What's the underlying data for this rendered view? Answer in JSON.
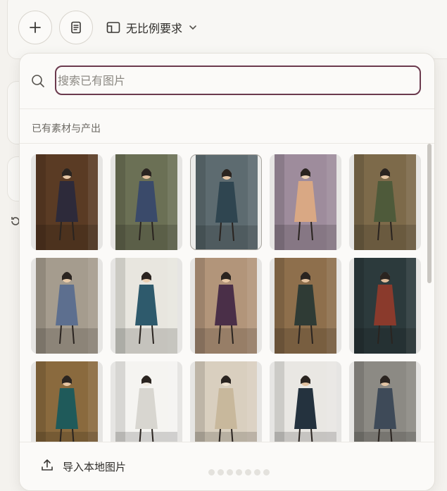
{
  "toolbar": {
    "add_icon": "plus-icon",
    "doc_icon": "document-icon",
    "ratio_icon": "aspect-ratio-icon",
    "ratio_label": "无比例要求",
    "ratio_chevron": "chevron-down-icon"
  },
  "picker": {
    "search_placeholder": "搜索已有图片",
    "section_title": "已有素材与产出",
    "upload_label": "导入本地图片",
    "accent_color": "#6b3a4e"
  },
  "thumbnails": [
    {
      "row": 0,
      "col": 0,
      "bg": "#5a3b24",
      "fig": "#2d2a3a",
      "skin": "#e8c9a8",
      "selected": false
    },
    {
      "row": 0,
      "col": 1,
      "bg": "#6b7055",
      "fig": "#3a4a6a",
      "skin": "#e3c09c",
      "selected": false
    },
    {
      "row": 0,
      "col": 2,
      "bg": "#5d6b70",
      "fig": "#2f4550",
      "skin": "#e5c6a6",
      "selected": true
    },
    {
      "row": 0,
      "col": 3,
      "bg": "#9e8c9c",
      "fig": "#d9a884",
      "skin": "#edd2b6",
      "selected": false
    },
    {
      "row": 0,
      "col": 4,
      "bg": "#7d6a4a",
      "fig": "#4e5a3a",
      "skin": "#e6c7a5",
      "selected": false
    },
    {
      "row": 1,
      "col": 0,
      "bg": "#a59c8e",
      "fig": "#5d6f8f",
      "skin": "#e8caa8",
      "selected": false
    },
    {
      "row": 1,
      "col": 1,
      "bg": "#e8e6df",
      "fig": "#2e5a6c",
      "skin": "#ecd0b2",
      "selected": false
    },
    {
      "row": 1,
      "col": 2,
      "bg": "#b2957a",
      "fig": "#4a2f48",
      "skin": "#e7c8a5",
      "selected": false
    },
    {
      "row": 1,
      "col": 3,
      "bg": "#8e6f4c",
      "fig": "#2f3b35",
      "skin": "#e5c39f",
      "selected": false
    },
    {
      "row": 1,
      "col": 4,
      "bg": "#2c3a3c",
      "fig": "#8a3a2c",
      "skin": "#e0bd9a",
      "selected": false
    },
    {
      "row": 2,
      "col": 0,
      "bg": "#8a6a3e",
      "fig": "#1f5a5a",
      "skin": "#e6c5a2",
      "selected": false
    },
    {
      "row": 2,
      "col": 1,
      "bg": "#f5f4f1",
      "fig": "#d8d6d0",
      "skin": "#f2ece2",
      "selected": false
    },
    {
      "row": 2,
      "col": 2,
      "bg": "#d9cfbf",
      "fig": "#c8b89c",
      "skin": "#efe2cf",
      "selected": false
    },
    {
      "row": 2,
      "col": 3,
      "bg": "#e9e7e3",
      "fig": "#24323e",
      "skin": "#e3c3a2",
      "selected": false
    },
    {
      "row": 2,
      "col": 4,
      "bg": "#8c8a84",
      "fig": "#3e4a58",
      "skin": "#e2c4a4",
      "selected": false
    }
  ]
}
